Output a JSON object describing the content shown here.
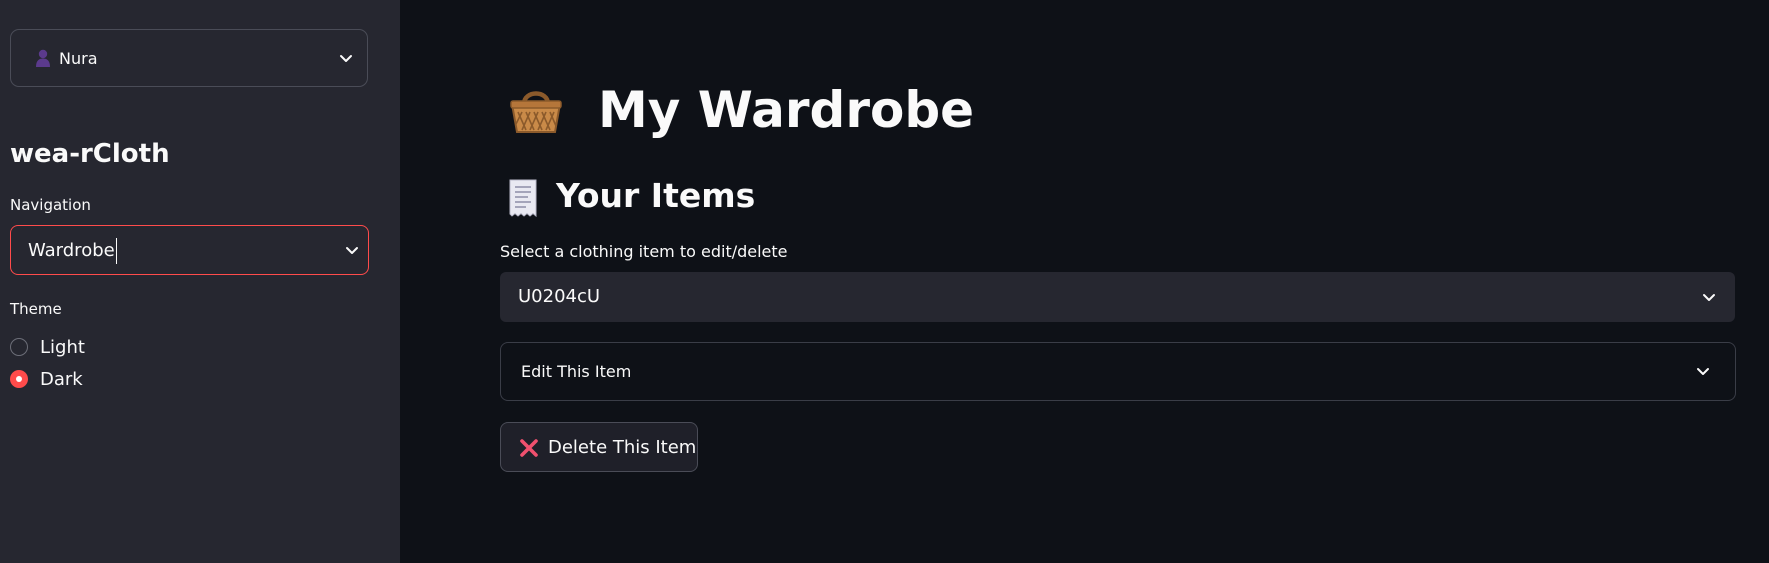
{
  "sidebar": {
    "user": {
      "name": "Nura",
      "icon": "user-silhouette-icon"
    },
    "app_title": "wea-rCloth",
    "navigation": {
      "label": "Navigation",
      "selected": "Wardrobe"
    },
    "theme": {
      "label": "Theme",
      "options": [
        "Light",
        "Dark"
      ],
      "selected": "Dark"
    }
  },
  "main": {
    "page_title": {
      "icon": "basket-icon",
      "text": "My Wardrobe"
    },
    "section": {
      "icon": "receipt-icon",
      "text": "Your Items"
    },
    "item_select": {
      "label": "Select a clothing item to edit/delete",
      "value": "U0204cU"
    },
    "expander": {
      "label": "Edit This Item"
    },
    "delete_button": {
      "icon": "cross-mark-icon",
      "label": "Delete This Item"
    }
  },
  "colors": {
    "main_bg": "#0e1117",
    "sidebar_bg": "#262730",
    "accent": "#ff4b4b",
    "text": "#fafafa"
  }
}
